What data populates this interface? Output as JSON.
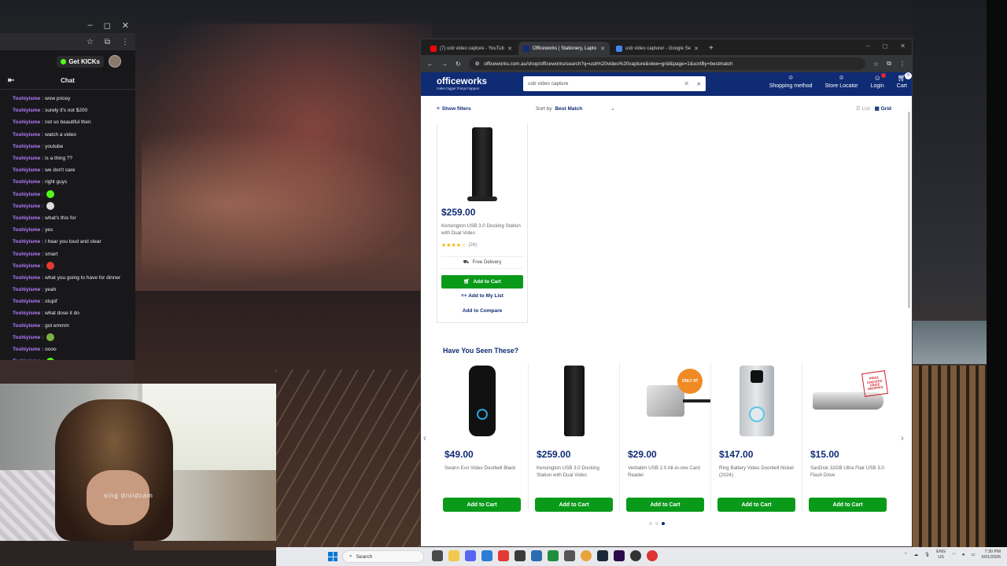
{
  "chat": {
    "window_controls": [
      "–",
      "◻",
      "✕"
    ],
    "kick_label": "Get KICKs",
    "header_title": "Chat",
    "messages": [
      {
        "user": "Toshiyisme",
        "text": "wow pricey"
      },
      {
        "user": "Toshiyisme",
        "text": "surely it's not $200"
      },
      {
        "user": "Toshiyisme",
        "text": "not so beautiful then"
      },
      {
        "user": "Toshiyisme",
        "text": "watch a video"
      },
      {
        "user": "Toshiyisme",
        "text": "youtube"
      },
      {
        "user": "Toshiyisme",
        "text": "is a thing ??"
      },
      {
        "user": "Toshiyisme",
        "text": "we don't care"
      },
      {
        "user": "Toshiyisme",
        "text": "right guys"
      },
      {
        "user": "Toshiyisme",
        "text": "",
        "emote": "#53fc18"
      },
      {
        "user": "Toshiyisme",
        "text": "",
        "emote": "#dddddd"
      },
      {
        "user": "Toshiyisme",
        "text": "what's this for"
      },
      {
        "user": "Toshiyisme",
        "text": "yes"
      },
      {
        "user": "Toshiyisme",
        "text": "I hear you loud and clear"
      },
      {
        "user": "Toshiyisme",
        "text": "smart"
      },
      {
        "user": "Toshiyisme",
        "text": "",
        "emote": "#e53935"
      },
      {
        "user": "Toshiyisme",
        "text": "what you going to have for dinner"
      },
      {
        "user": "Toshiyisme",
        "text": "yeah"
      },
      {
        "user": "Toshiyisme",
        "text": "stupif"
      },
      {
        "user": "Toshiyisme",
        "text": "what dose it do"
      },
      {
        "user": "Toshiyisme",
        "text": "got emmm"
      },
      {
        "user": "Toshiyisme",
        "text": "",
        "emote": "#7cb342"
      },
      {
        "user": "Toshiyisme",
        "text": "oooo"
      },
      {
        "user": "Toshiyisme",
        "text": "",
        "emote": "#53fc18"
      }
    ]
  },
  "webcam": {
    "caption": "sing droidcam"
  },
  "browser": {
    "tabs": [
      {
        "title": "(7) usb video capture - YouTub",
        "favicon": "#ff0000",
        "active": false
      },
      {
        "title": "Officeworks | Stationery, Lapto",
        "favicon": "#0f2b74",
        "active": true
      },
      {
        "title": "usb video capturer - Google Se",
        "favicon": "#4285f4",
        "active": false
      }
    ],
    "new_tab": "+",
    "url": "officeworks.com.au/shop/officeworks/search?q=usb%20video%20capture&view=grid&page=1&sortBy=bestmatch"
  },
  "site": {
    "logo": "officeworks",
    "tagline": "make bigger things happen",
    "search_value": "usb video capture",
    "nav": [
      {
        "label": "Shopping method",
        "icon": "location-pin"
      },
      {
        "label": "Store Locator",
        "icon": "location-pin"
      },
      {
        "label": "Login",
        "icon": "user"
      },
      {
        "label": "Cart",
        "icon": "cart",
        "badge": "0"
      }
    ],
    "show_filters": "Show filters",
    "sort_label": "Sort by",
    "sort_value": "Best Match",
    "view_list": "List",
    "view_grid": "Grid"
  },
  "product": {
    "price": "$259.00",
    "name": "Kensington USB 3.0 Docking Station with Dual Video",
    "rating_stars": "★★★★☆",
    "rating_value": 4,
    "review_count": "(26)",
    "delivery": "Free Delivery",
    "add_to_cart": "Add to Cart",
    "add_to_list": "Add to My List",
    "add_to_compare": "Add to Compare"
  },
  "seen": {
    "title": "Have You Seen These?",
    "items": [
      {
        "price": "$49.00",
        "name": "Swann Evo Video Doorbell Black",
        "cart": "Add to Cart",
        "image": "doorbell-black"
      },
      {
        "price": "$259.00",
        "name": "Kensington USB 3.0 Docking Station with Dual Video",
        "cart": "Add to Cart",
        "image": "docking-station"
      },
      {
        "price": "$29.00",
        "name": "Verbatim USB 2.0 All-in-one Card Reader",
        "cart": "Add to Cart",
        "image": "card-reader",
        "badge": "ONLY AT"
      },
      {
        "price": "$147.00",
        "name": "Ring Battery Video Doorbell Nickel (2024)",
        "cart": "Add to Cart",
        "image": "doorbell-nickel"
      },
      {
        "price": "$15.00",
        "name": "SanDisk 32GB Ultra Flair USB 3.0 Flash Drive",
        "cart": "Add to Cart",
        "image": "flash-drive",
        "stamp": "PRICE CHECKED PRICE DROPPED"
      }
    ],
    "page_index": 2,
    "page_count": 3
  },
  "taskbar": {
    "search": "Search",
    "lang_top": "ENG",
    "lang_bottom": "US",
    "time": "7:30 PM",
    "date": "5/01/2026"
  }
}
